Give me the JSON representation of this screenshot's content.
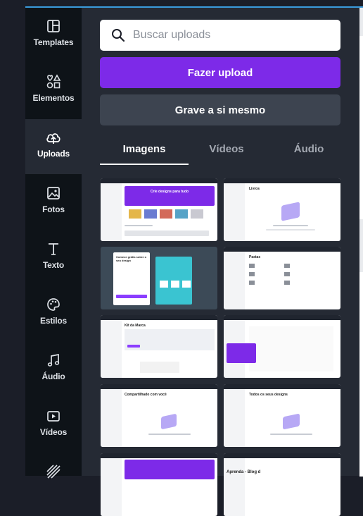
{
  "sidebar": {
    "items": [
      {
        "label": "Templates",
        "icon": "templates-icon"
      },
      {
        "label": "Elementos",
        "icon": "elements-icon"
      },
      {
        "label": "Uploads",
        "icon": "uploads-icon",
        "active": true
      },
      {
        "label": "Fotos",
        "icon": "photos-icon"
      },
      {
        "label": "Texto",
        "icon": "text-icon"
      },
      {
        "label": "Estilos",
        "icon": "styles-icon"
      },
      {
        "label": "Áudio",
        "icon": "audio-icon"
      },
      {
        "label": "Vídeos",
        "icon": "videos-icon"
      }
    ]
  },
  "panel": {
    "search_placeholder": "Buscar uploads",
    "upload_button": "Fazer upload",
    "record_button": "Grave a si mesmo",
    "tabs": [
      {
        "label": "Imagens",
        "active": true
      },
      {
        "label": "Vídeos"
      },
      {
        "label": "Áudio"
      }
    ]
  },
  "thumbnails": [
    {
      "title": "Crie designs para tudo"
    },
    {
      "title": "Livros"
    },
    {
      "title": "Comece grátis sobre o seu design"
    },
    {
      "title": "Pastas"
    },
    {
      "title": "Kit da Marca"
    },
    {
      "title": ""
    },
    {
      "title": "Compartilhado com você"
    },
    {
      "title": "Todos os seus designs"
    },
    {
      "title": ""
    },
    {
      "title": "Aprenda - Blog d"
    }
  ],
  "colors": {
    "accent": "#7d2ae8",
    "rail_bg": "#0e1318",
    "panel_bg": "#252a34"
  }
}
